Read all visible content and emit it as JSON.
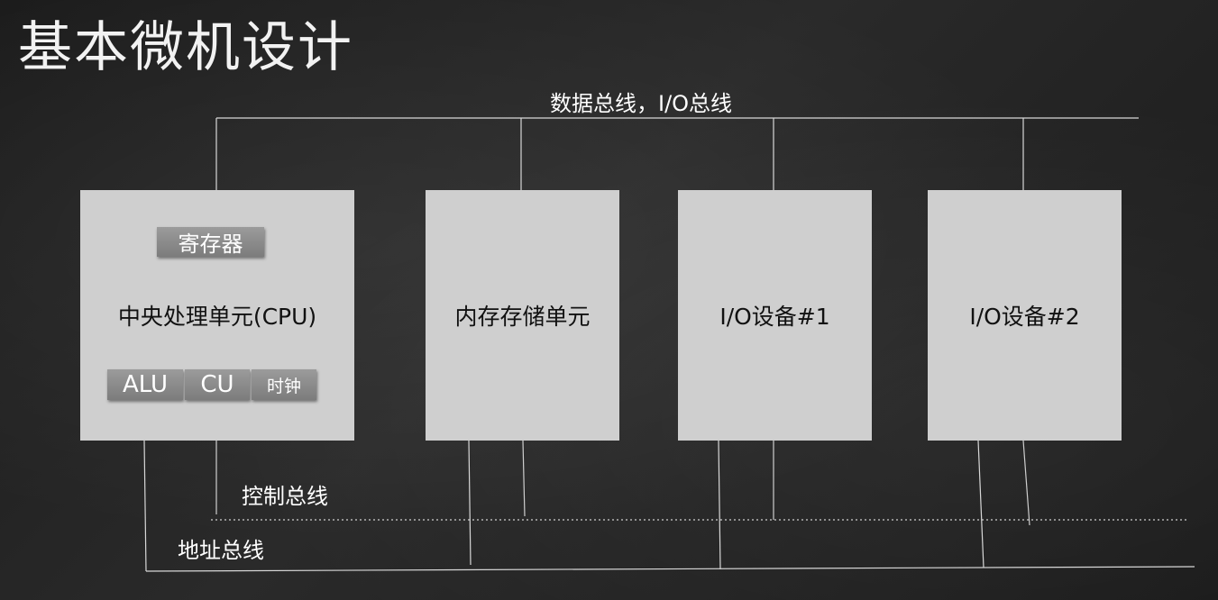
{
  "title": "基本微机设计",
  "buses": {
    "data_io": "数据总线，I/O总线",
    "control": "控制总线",
    "address": "地址总线"
  },
  "cpu": {
    "label": "中央处理单元(CPU)",
    "register": "寄存器",
    "alu": "ALU",
    "cu": "CU",
    "clock": "时钟"
  },
  "memory": {
    "label": "内存存储单元"
  },
  "io1": {
    "label": "I/O设备#1"
  },
  "io2": {
    "label": "I/O设备#2"
  }
}
